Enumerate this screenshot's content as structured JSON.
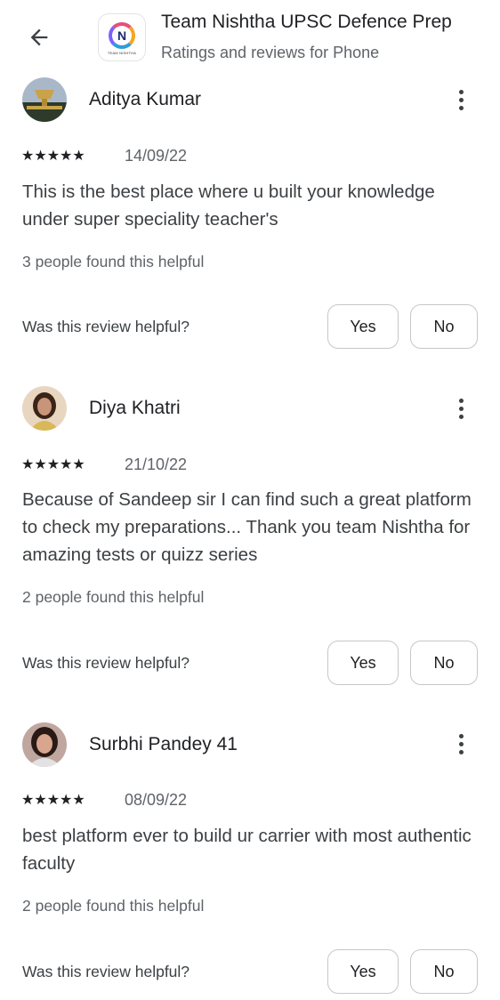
{
  "header": {
    "back_icon": "arrow-back-icon",
    "app_icon": "team-nishtha-logo",
    "app_icon_letter": "N",
    "app_icon_caption": "TEAM NISHTHA",
    "title": "Team Nishtha UPSC Defence Prep",
    "subtitle": "Ratings and reviews for Phone"
  },
  "colors": {
    "star": "#1a73e8",
    "text": "#202124",
    "muted": "#5f6368"
  },
  "reviews": [
    {
      "name": "Aditya Kumar",
      "rating": 5,
      "stars": "★★★★★",
      "date": "14/09/22",
      "text": "This is the best place where u built your knowledge under super speciality teacher's",
      "helpful_count": "3 people found this helpful",
      "helpful_question": "Was this review helpful?",
      "yes_label": "Yes",
      "no_label": "No"
    },
    {
      "name": "Diya Khatri",
      "rating": 5,
      "stars": "★★★★★",
      "date": "21/10/22",
      "text": "Because of Sandeep sir I can find such a great platform to check my preparations... Thank you team Nishtha for amazing tests or quizz series",
      "helpful_count": "2 people found this helpful",
      "helpful_question": "Was this review helpful?",
      "yes_label": "Yes",
      "no_label": "No"
    },
    {
      "name": "Surbhi Pandey 41",
      "rating": 5,
      "stars": "★★★★★",
      "date": "08/09/22",
      "text": "best platform ever to build ur carrier with most authentic faculty",
      "helpful_count": "2 people found this helpful",
      "helpful_question": "Was this review helpful?",
      "yes_label": "Yes",
      "no_label": "No"
    }
  ]
}
